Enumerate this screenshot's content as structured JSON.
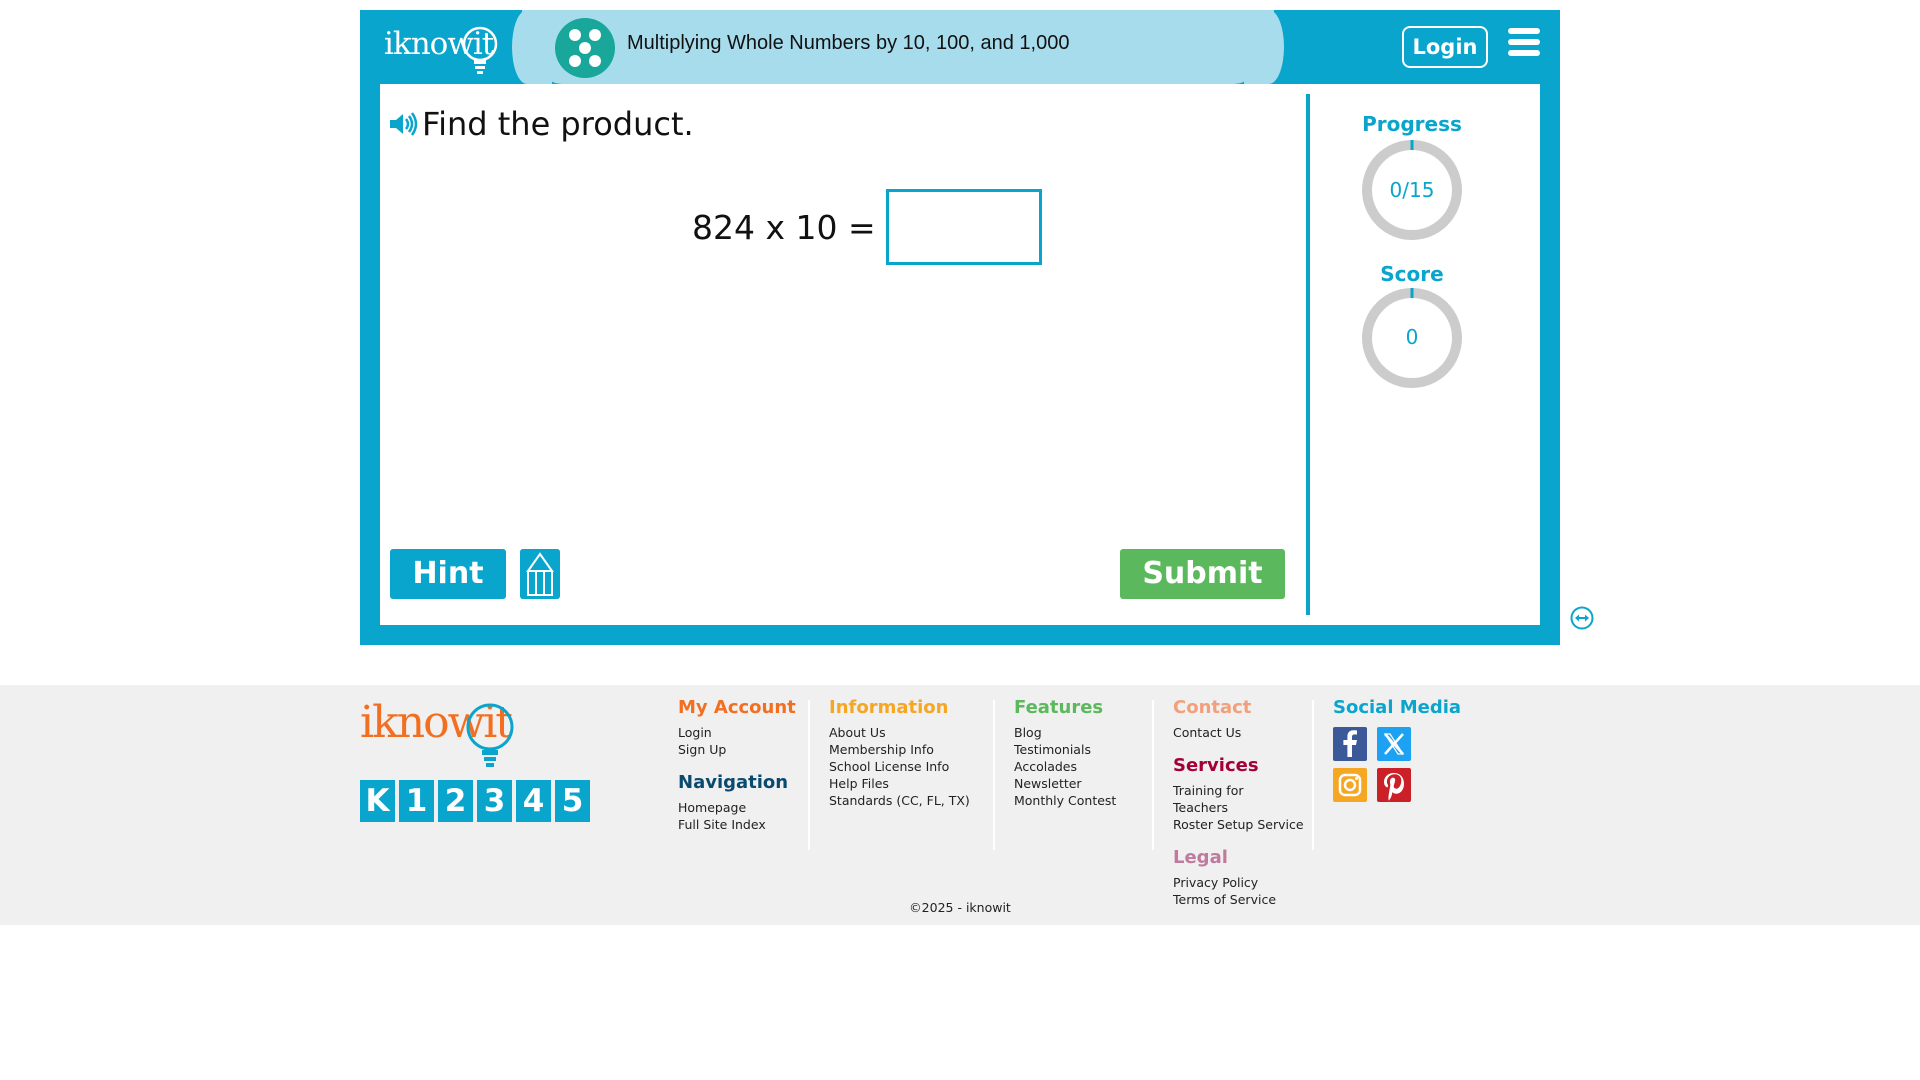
{
  "header": {
    "logo_text": "iknowit",
    "topic_title": "Multiplying Whole Numbers by 10, 100, and 1,000",
    "login_label": "Login"
  },
  "question": {
    "prompt": "Find the product.",
    "equation": "824 x 10 =",
    "answer_value": "",
    "answer_placeholder": ""
  },
  "buttons": {
    "hint_label": "Hint",
    "submit_label": "Submit"
  },
  "sidebar": {
    "progress_label": "Progress",
    "progress_value": "0/15",
    "progress_fraction": 0,
    "score_label": "Score",
    "score_value": "0"
  },
  "colors": {
    "brand_blue": "#0aa5cc",
    "title_pill": "#a7dced",
    "submit_green": "#5cb85c",
    "logo_orange": "#f26f21"
  },
  "footer": {
    "logo_text": "iknowit",
    "grades": [
      "K",
      "1",
      "2",
      "3",
      "4",
      "5"
    ],
    "my_account": {
      "title": "My Account",
      "links": [
        "Login",
        "Sign Up"
      ]
    },
    "navigation": {
      "title": "Navigation",
      "links": [
        "Homepage",
        "Full Site Index"
      ]
    },
    "information": {
      "title": "Information",
      "links": [
        "About Us",
        "Membership Info",
        "School License Info",
        "Help Files",
        "Standards (CC, FL, TX)"
      ]
    },
    "features": {
      "title": "Features",
      "links": [
        "Blog",
        "Testimonials",
        "Accolades",
        "Newsletter",
        "Monthly Contest"
      ]
    },
    "contact": {
      "title": "Contact",
      "links": [
        "Contact Us"
      ]
    },
    "services": {
      "title": "Services",
      "links": [
        "Training for",
        "Teachers",
        "Roster Setup Service"
      ]
    },
    "legal": {
      "title": "Legal",
      "links": [
        "Privacy Policy",
        "Terms of Service"
      ]
    },
    "social_media": {
      "title": "Social Media",
      "icons": [
        "facebook-icon",
        "x-icon",
        "instagram-icon",
        "pinterest-icon"
      ]
    },
    "copyright": "©2025 - iknowit"
  }
}
